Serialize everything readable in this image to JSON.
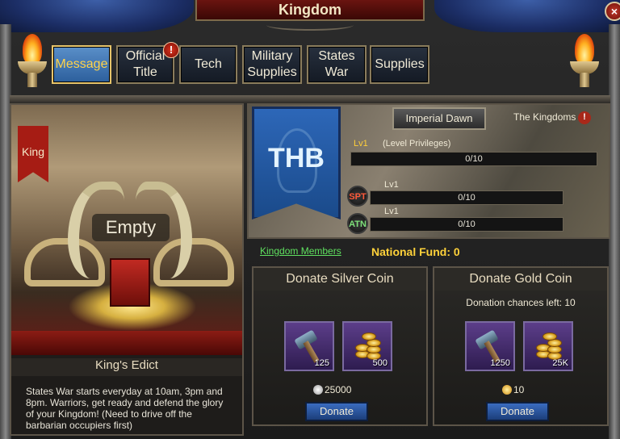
{
  "window": {
    "title": "Kingdom",
    "close_label": "×"
  },
  "tabs": [
    {
      "label": "Message",
      "active": true
    },
    {
      "label": "Official Title",
      "alert": "!"
    },
    {
      "label": "Tech"
    },
    {
      "label": "Military Supplies"
    },
    {
      "label": "States War"
    },
    {
      "label": "Supplies"
    }
  ],
  "throne": {
    "banner": "King",
    "status": "Empty",
    "edict_title": "King's Edict",
    "edict_text": "States War starts everyday at 10am, 3pm and 8pm. Warriors, get ready and defend the glory of your Kingdom! (Need to drive off the barbarian occupiers first)"
  },
  "kingdom": {
    "flag_abbr": "THB",
    "rank_button": "Imperial Dawn",
    "kingdoms_link": "The Kingdoms",
    "info_icon": "!",
    "level": "Lv1",
    "level_note": "(Level Privileges)",
    "level_progress": "0/10",
    "level_progress_fraction": 0,
    "spt": {
      "badge": "SPT",
      "level": "Lv1",
      "progress": "0/10",
      "fraction": 0
    },
    "atn": {
      "badge": "ATN",
      "level": "Lv1",
      "progress": "0/10",
      "fraction": 0
    },
    "members_link": "Kingdom Members",
    "national_fund": "National Fund: 0"
  },
  "donate_silver": {
    "title": "Donate Silver Coin",
    "items": [
      {
        "icon": "hammer-icon",
        "qty": "125"
      },
      {
        "icon": "coins-icon",
        "qty": "500"
      }
    ],
    "cost": "25000",
    "button": "Donate"
  },
  "donate_gold": {
    "title": "Donate Gold Coin",
    "chances": "Donation chances left: 10",
    "items": [
      {
        "icon": "hammer-icon",
        "qty": "1250"
      },
      {
        "icon": "coins-icon",
        "qty": "25K"
      }
    ],
    "cost": "10",
    "button": "Donate"
  },
  "colors": {
    "accent_gold": "#ffd23a",
    "link_green": "#5fe05f",
    "tab_active": "#2c5f9c",
    "flag_blue": "#2d67b8"
  }
}
